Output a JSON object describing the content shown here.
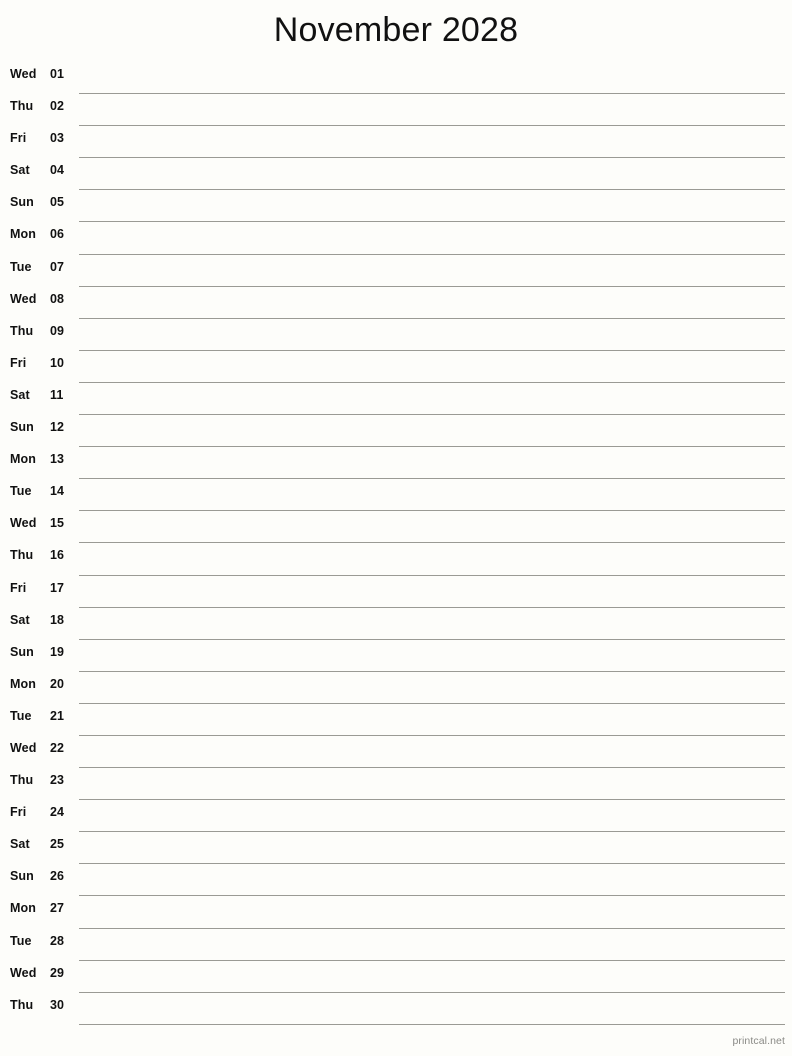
{
  "document": {
    "title": "November 2028",
    "month": "November",
    "year": "2028",
    "type": "single-column-notes-calendar",
    "background_color": "#fdfdfa",
    "rule_color": "#9a9a94",
    "text_color": "#111111"
  },
  "footer": {
    "credit": "printcal.net",
    "color": "#8a8a86"
  },
  "days": [
    {
      "weekday": "Wed",
      "date": "01"
    },
    {
      "weekday": "Thu",
      "date": "02"
    },
    {
      "weekday": "Fri",
      "date": "03"
    },
    {
      "weekday": "Sat",
      "date": "04"
    },
    {
      "weekday": "Sun",
      "date": "05"
    },
    {
      "weekday": "Mon",
      "date": "06"
    },
    {
      "weekday": "Tue",
      "date": "07"
    },
    {
      "weekday": "Wed",
      "date": "08"
    },
    {
      "weekday": "Thu",
      "date": "09"
    },
    {
      "weekday": "Fri",
      "date": "10"
    },
    {
      "weekday": "Sat",
      "date": "11"
    },
    {
      "weekday": "Sun",
      "date": "12"
    },
    {
      "weekday": "Mon",
      "date": "13"
    },
    {
      "weekday": "Tue",
      "date": "14"
    },
    {
      "weekday": "Wed",
      "date": "15"
    },
    {
      "weekday": "Thu",
      "date": "16"
    },
    {
      "weekday": "Fri",
      "date": "17"
    },
    {
      "weekday": "Sat",
      "date": "18"
    },
    {
      "weekday": "Sun",
      "date": "19"
    },
    {
      "weekday": "Mon",
      "date": "20"
    },
    {
      "weekday": "Tue",
      "date": "21"
    },
    {
      "weekday": "Wed",
      "date": "22"
    },
    {
      "weekday": "Thu",
      "date": "23"
    },
    {
      "weekday": "Fri",
      "date": "24"
    },
    {
      "weekday": "Sat",
      "date": "25"
    },
    {
      "weekday": "Sun",
      "date": "26"
    },
    {
      "weekday": "Mon",
      "date": "27"
    },
    {
      "weekday": "Tue",
      "date": "28"
    },
    {
      "weekday": "Wed",
      "date": "29"
    },
    {
      "weekday": "Thu",
      "date": "30"
    }
  ]
}
